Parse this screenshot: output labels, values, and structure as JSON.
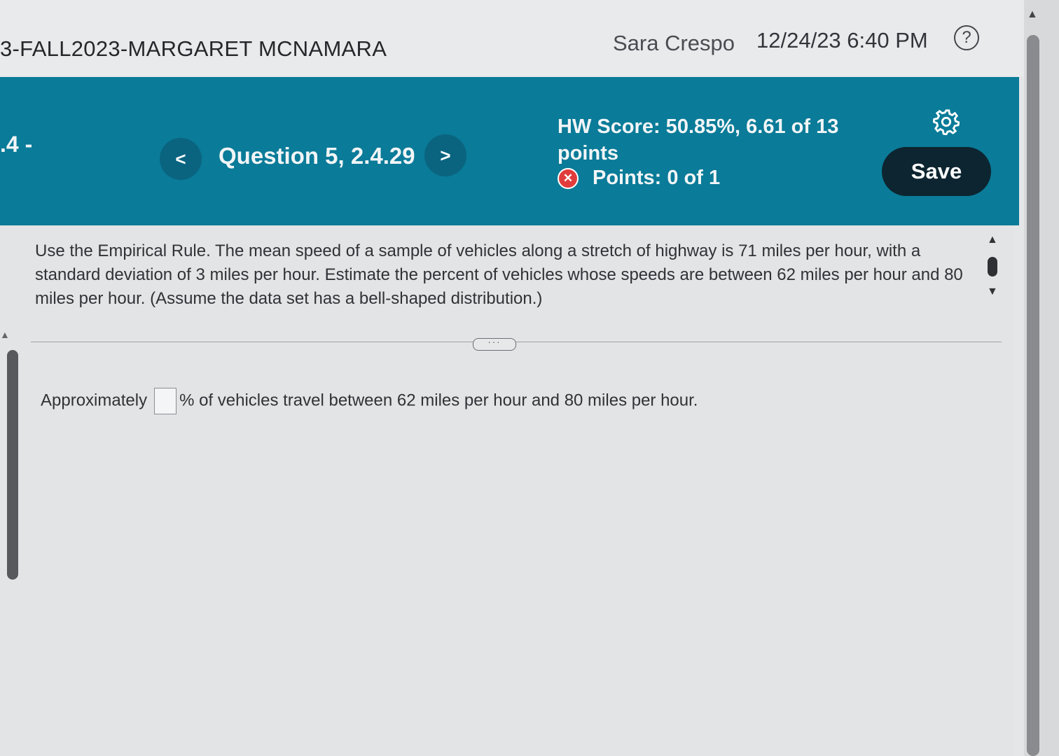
{
  "header": {
    "course_title": "3-FALL2023-MARGARET MCNAMARA",
    "user_name": "Sara Crespo",
    "datetime": "12/24/23 6:40 PM",
    "help_label": "?"
  },
  "banner": {
    "section_label": ".4 -",
    "prev_label": "<",
    "question_label": "Question 5, 2.4.29",
    "next_label": ">",
    "hw_score": "HW Score: 50.85%, 6.61 of 13 points",
    "points": "Points: 0 of 1",
    "save_label": "Save"
  },
  "question": {
    "text": "Use the Empirical Rule. The mean speed of a sample of vehicles along a stretch of highway is 71 miles per hour, with a standard deviation of 3 miles per hour. Estimate the percent of vehicles whose speeds are between 62 miles per hour and 80 miles per hour. (Assume the data set has a bell-shaped distribution.)"
  },
  "divider": {
    "more_label": "···"
  },
  "answer": {
    "prefix": "Approximately",
    "value": "",
    "suffix": "% of vehicles travel between 62 miles per hour and 80 miles per hour."
  },
  "colors": {
    "banner": "#0a7b98",
    "save_button": "#0d2530",
    "error_icon": "#e13c3c"
  }
}
